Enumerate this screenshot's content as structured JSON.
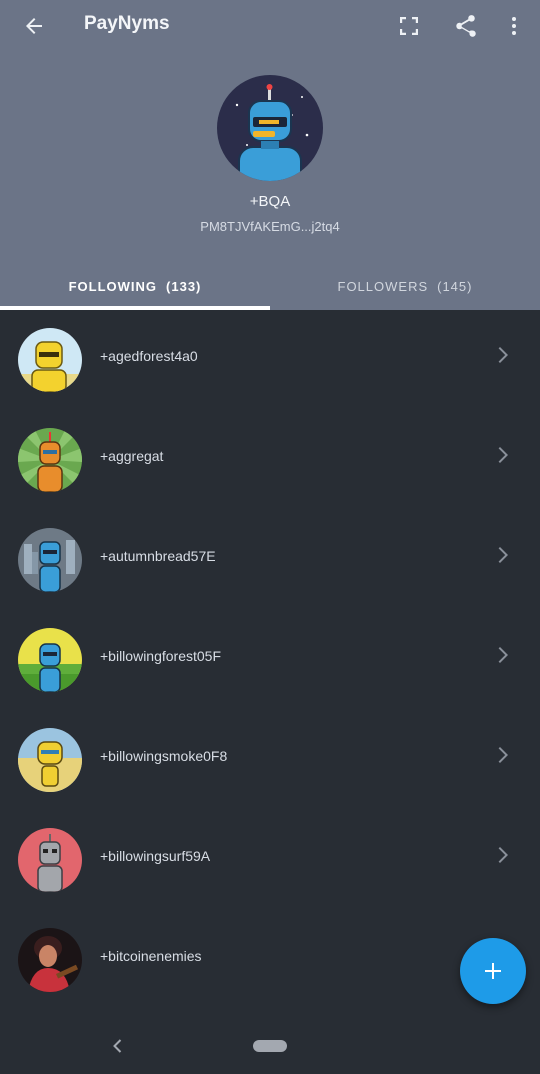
{
  "app_bar": {
    "title": "PayNyms",
    "back_icon": "arrow-left-icon",
    "actions": [
      "fullscreen-icon",
      "share-icon",
      "more-vert-icon"
    ]
  },
  "profile": {
    "name": "+BQA",
    "code": "PM8TJVfAKEmG...j2tq4"
  },
  "tabs": [
    {
      "label": "FOLLOWING",
      "count": "(133)",
      "selected": true
    },
    {
      "label": "FOLLOWERS",
      "count": "(145)",
      "selected": false
    }
  ],
  "paynyms": [
    {
      "name": "+agedforest4a0",
      "has_chevron": true
    },
    {
      "name": "+aggregat",
      "has_chevron": true
    },
    {
      "name": "+autumnbread57E",
      "has_chevron": true
    },
    {
      "name": "+billowingforest05F",
      "has_chevron": true
    },
    {
      "name": "+billowingsmoke0F8",
      "has_chevron": true
    },
    {
      "name": "+billowingsurf59A",
      "has_chevron": true
    },
    {
      "name": "+bitcoinenemies",
      "has_chevron": false
    }
  ],
  "fab": {
    "icon": "plus-icon"
  },
  "colors": {
    "header_bg": "#6b7487",
    "list_bg": "#282d34",
    "accent": "#1e9be8"
  }
}
